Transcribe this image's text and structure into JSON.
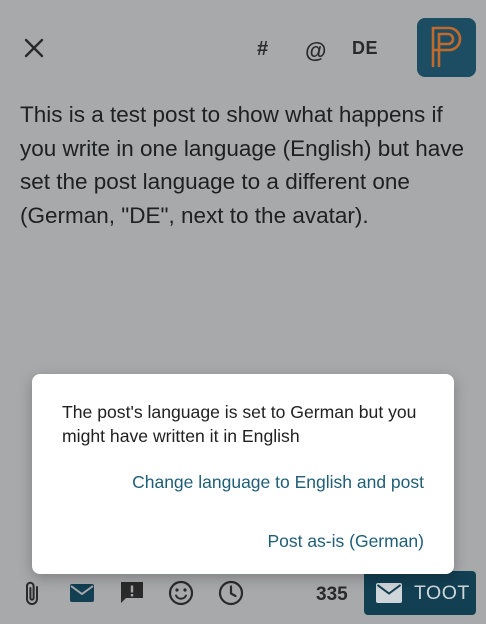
{
  "header": {
    "hashtag_label": "#",
    "mention_label": "@",
    "language_label": "DE",
    "icons": [
      "close-icon",
      "avatar-logo"
    ]
  },
  "post": {
    "text": "This is a test post to show what happens if you write in one language (English) but have set the post language to a different one (German, \"DE\", next to the avatar)."
  },
  "dialog": {
    "message": "The post's language is set to German but you might have written it in English",
    "change_button": "Change language to English and post",
    "post_as_is_button": "Post as-is (German)"
  },
  "toolbar": {
    "icons": [
      "attach-icon",
      "visibility-mail-icon",
      "content-warning-icon",
      "emoji-icon",
      "schedule-icon"
    ],
    "char_count": "335",
    "toot_label": "TOOT"
  },
  "colors": {
    "scrim_background": "#a8a9ab",
    "accent": "#123f52",
    "dialog_button_text": "#1f5e77",
    "avatar_bg": "#1c4d63",
    "avatar_fg": "#c26a2c"
  }
}
